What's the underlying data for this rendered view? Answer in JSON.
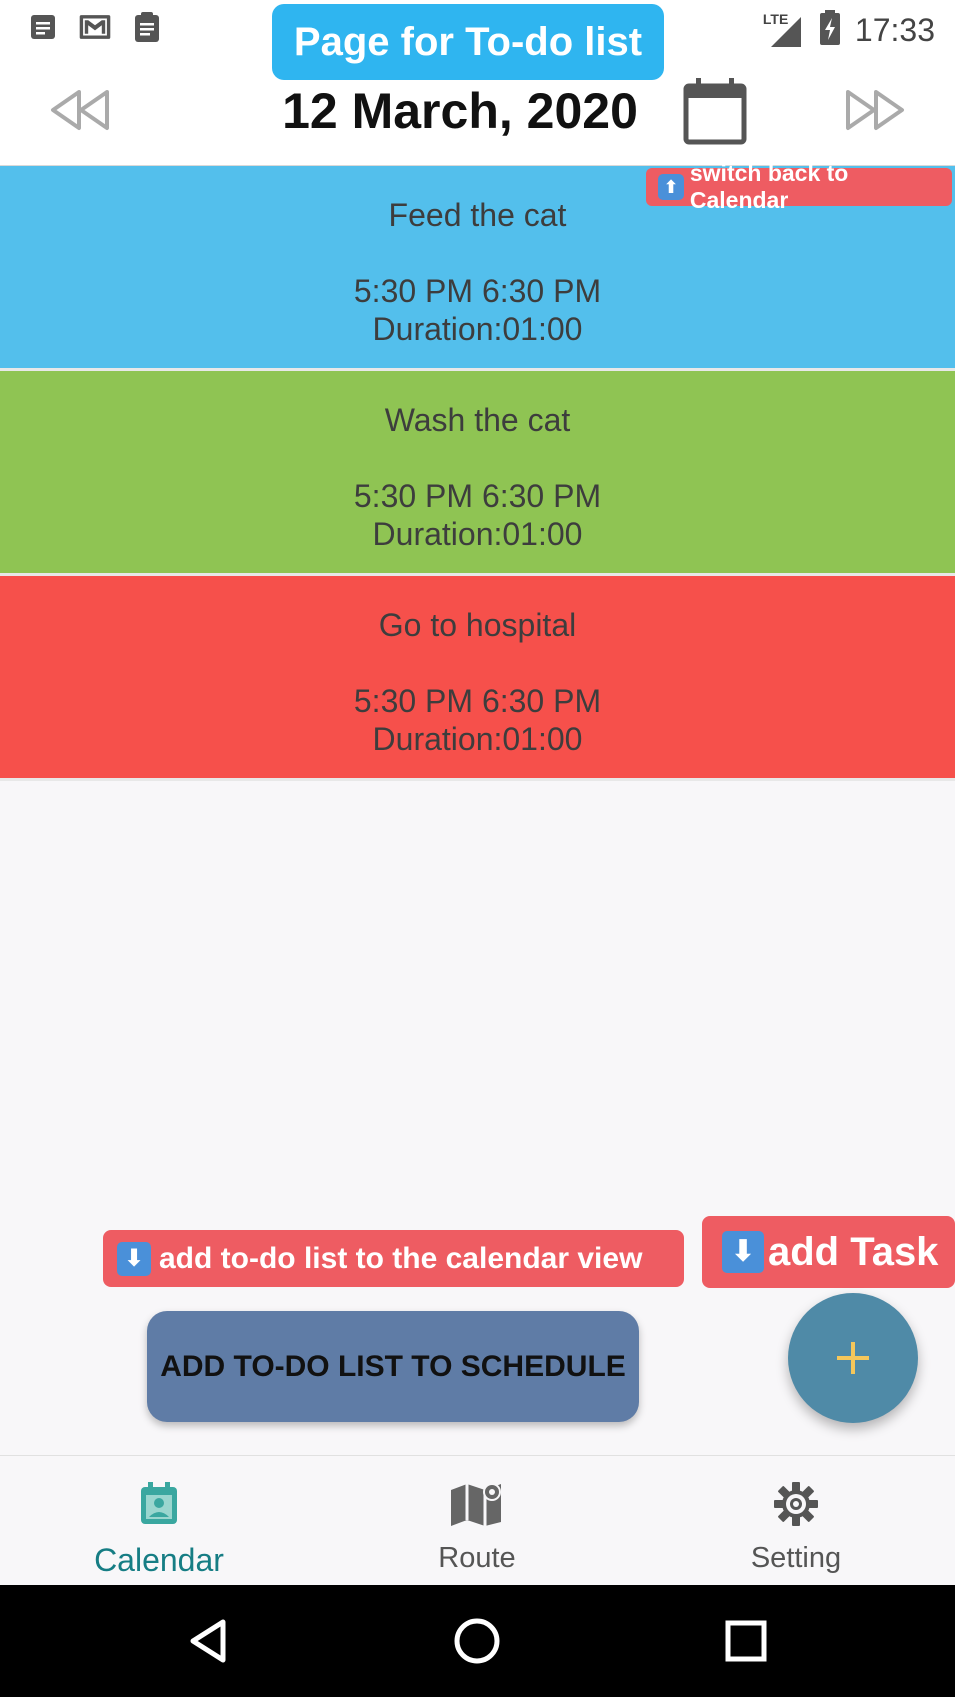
{
  "status_bar": {
    "time": "17:33",
    "network": "LTE",
    "left_icons": [
      "notes-icon",
      "mail-icon",
      "clipboard-icon"
    ]
  },
  "header": {
    "page_badge": "Page for To-do list",
    "date": "12 March, 2020"
  },
  "tasks": [
    {
      "name": "Feed the cat",
      "time": "5:30 PM 6:30 PM",
      "duration": "Duration:01:00",
      "color": "#53bfec"
    },
    {
      "name": "Wash the cat",
      "time": "5:30 PM 6:30 PM",
      "duration": "Duration:01:00",
      "color": "#8fc453"
    },
    {
      "name": "Go to hospital",
      "time": "5:30 PM 6:30 PM",
      "duration": "Duration:01:00",
      "color": "#f6504b"
    }
  ],
  "annotations": {
    "switch_back": "switch back to Calendar",
    "add_list": "add to-do list to the calendar view",
    "add_task": "add Task",
    "emoji_up": "⬆",
    "emoji_down": "⬇"
  },
  "actions": {
    "schedule_label": "ADD TO-DO LIST TO SCHEDULE"
  },
  "bottom_nav": [
    {
      "label": "Calendar",
      "icon": "calendar-person-icon",
      "active": true
    },
    {
      "label": "Route",
      "icon": "map-icon",
      "active": false
    },
    {
      "label": "Setting",
      "icon": "gear-icon",
      "active": false
    }
  ],
  "colors": {
    "accent": "#2fb5f0",
    "annotation_red": "#ee5c62",
    "fab": "#4f8aa7",
    "schedule_button": "#5f7ca6",
    "active_nav": "#167d84"
  }
}
